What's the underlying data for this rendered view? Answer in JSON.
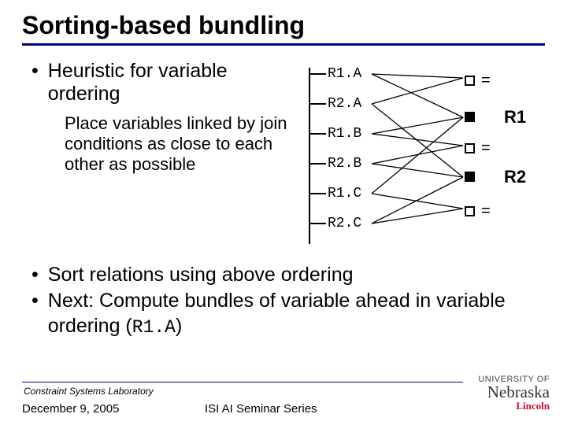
{
  "title": "Sorting-based bundling",
  "bullet1": "Heuristic for variable ordering",
  "sub": "Place variables linked by join conditions as close to each other as possible",
  "vars": [
    "R1.A",
    "R2.A",
    "R1.B",
    "R2.B",
    "R1.C",
    "R2.C"
  ],
  "relation_labels": [
    "R1",
    "R2"
  ],
  "bullet2": "Sort relations using above ordering",
  "bullet3_prefix": "Next: Compute bundles of variable ahead in variable ordering (",
  "bullet3_code": "R1.A",
  "bullet3_suffix": ")",
  "lab": "Constraint Systems Laboratory",
  "date": "December 9, 2005",
  "series": "ISI AI Seminar Series",
  "logo": {
    "line1": "UNIVERSITY OF",
    "line2": "Nebraska",
    "line3": "Lincoln"
  }
}
